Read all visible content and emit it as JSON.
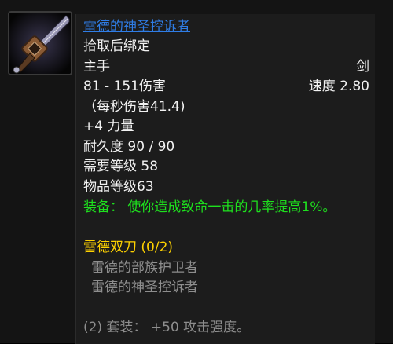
{
  "item": {
    "icon": "sword-icon",
    "name": "雷德的神圣控诉者",
    "binding": "拾取后绑定",
    "slot": "主手",
    "type": "剑",
    "damage": "81 - 151伤害",
    "speed": "速度 2.80",
    "dps": "（每秒伤害41.4)",
    "stat": "+4 力量",
    "durability": "耐久度 90 / 90",
    "required_level": "需要等级 58",
    "item_level": "物品等级63",
    "equip_effect": "装备： 使你造成致命一击的几率提高1%。"
  },
  "set": {
    "title": "雷德双刀 (0/2)",
    "pieces": [
      "雷德的部族护卫者",
      "雷德的神圣控诉者"
    ],
    "bonus": "(2) 套装： +50 攻击强度。"
  },
  "colors": {
    "item_name": "#2f7de6",
    "equip_effect": "#1ee01e",
    "set_title": "#ffd200",
    "set_piece": "#8e8e8e",
    "text": "#f2f2f2"
  }
}
